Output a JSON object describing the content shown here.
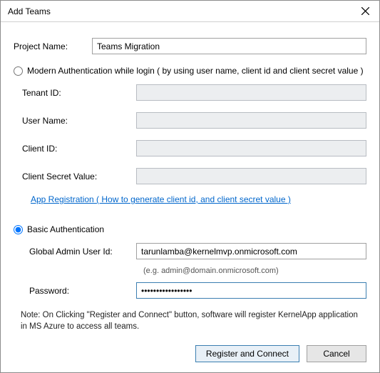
{
  "window": {
    "title": "Add Teams"
  },
  "project": {
    "label": "Project Name:",
    "value": "Teams Migration"
  },
  "modern": {
    "radio_label": "Modern Authentication while login ( by using user name, client id and client secret value )",
    "tenant_label": "Tenant ID:",
    "tenant_value": "",
    "user_label": "User Name:",
    "user_value": "",
    "clientid_label": "Client ID:",
    "clientid_value": "",
    "secret_label": "Client Secret Value:",
    "secret_value": "",
    "link": "App Registration ( How to generate client id, and client secret value )"
  },
  "basic": {
    "radio_label": "Basic Authentication",
    "admin_label": "Global Admin User Id:",
    "admin_value": "tarunlamba@kernelmvp.onmicrosoft.com",
    "admin_hint": "(e.g. admin@domain.onmicrosoft.com)",
    "password_label": "Password:",
    "password_value": "•••••••••••••••••"
  },
  "note": "Note: On Clicking \"Register and Connect\" button, software will register KernelApp application in MS Azure to access all teams.",
  "buttons": {
    "connect": "Register and Connect",
    "cancel": "Cancel"
  }
}
